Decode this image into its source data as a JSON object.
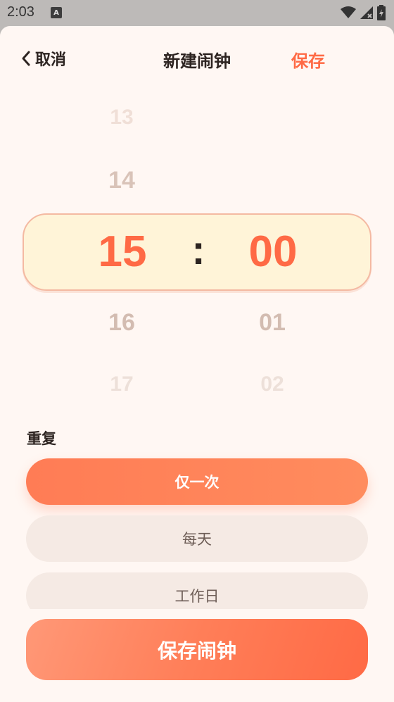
{
  "status_bar": {
    "time": "2:03",
    "indicator_letter": "A",
    "icons": [
      "wifi-icon",
      "signal-icon",
      "battery-icon"
    ]
  },
  "header": {
    "back_label": "取消",
    "title": "新建闹钟",
    "save_label": "保存"
  },
  "picker": {
    "hour": {
      "far_above": "13",
      "above": "14",
      "selected": "15",
      "below": "16",
      "far_below": "17"
    },
    "minute": {
      "selected": "00",
      "below": "01",
      "far_below": "02"
    },
    "separator": ":"
  },
  "repeat": {
    "label": "重复",
    "options": [
      {
        "label": "仅一次",
        "selected": true
      },
      {
        "label": "每天",
        "selected": false
      },
      {
        "label": "工作日",
        "selected": false
      }
    ]
  },
  "save_button": {
    "label": "保存闹钟"
  },
  "colors": {
    "accent": "#ff6a45",
    "background": "#fff7f3",
    "selection_fill": "#fff4d8",
    "text_dark": "#2d2421"
  }
}
